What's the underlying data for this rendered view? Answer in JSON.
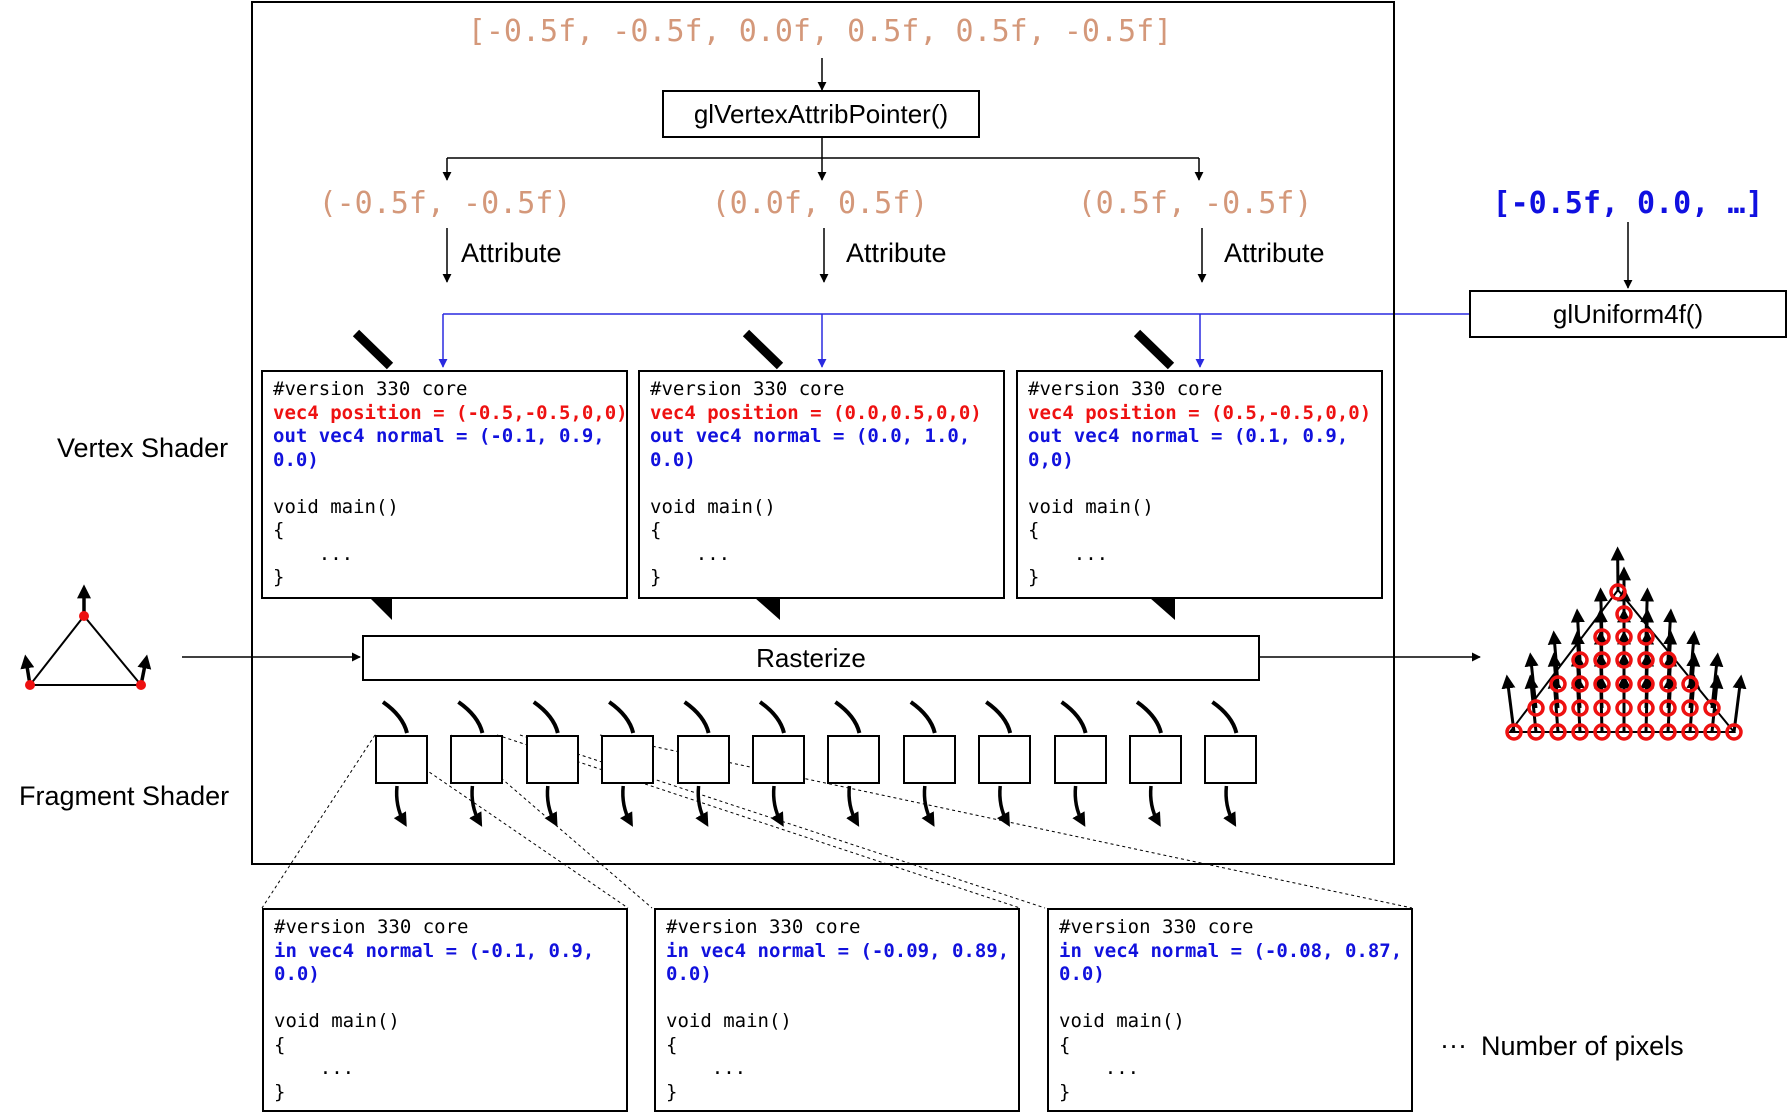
{
  "top_array": "[-0.5f, -0.5f, 0.0f, 0.5f, 0.5f, -0.5f]",
  "attrib_pointer_label": "glVertexAttribPointer()",
  "vertex_pairs": [
    "(-0.5f, -0.5f)",
    "(0.0f, 0.5f)",
    "(0.5f, -0.5f)"
  ],
  "attribute_label": "Attribute",
  "uniform_array": "[-0.5f, 0.0, …]",
  "uniform_call": "glUniform4f()",
  "vertex_shader_label": "Vertex Shader",
  "fragment_shader_label": "Fragment Shader",
  "rasterize_label": "Rasterize",
  "pixels_label": "Number of pixels",
  "ellipsis": "···",
  "vertex_shaders": [
    {
      "lines": [
        {
          "text": "#version 330 core",
          "style": "plain"
        },
        {
          "text": "vec4 position = (-0.5,-0.5,0,0)",
          "style": "red"
        },
        {
          "text": "out vec4 normal = (-0.1, 0.9,",
          "style": "blue"
        },
        {
          "text": "0.0)",
          "style": "blue"
        },
        {
          "text": "",
          "style": "plain"
        },
        {
          "text": "void main()",
          "style": "plain"
        },
        {
          "text": "{",
          "style": "plain"
        },
        {
          "text": "    ...",
          "style": "plain"
        },
        {
          "text": "}",
          "style": "plain"
        }
      ]
    },
    {
      "lines": [
        {
          "text": "#version 330 core",
          "style": "plain"
        },
        {
          "text": "vec4 position = (0.0,0.5,0,0)",
          "style": "red"
        },
        {
          "text": "out vec4 normal = (0.0, 1.0,",
          "style": "blue"
        },
        {
          "text": "0.0)",
          "style": "blue"
        },
        {
          "text": "",
          "style": "plain"
        },
        {
          "text": "void main()",
          "style": "plain"
        },
        {
          "text": "{",
          "style": "plain"
        },
        {
          "text": "    ...",
          "style": "plain"
        },
        {
          "text": "}",
          "style": "plain"
        }
      ]
    },
    {
      "lines": [
        {
          "text": "#version 330 core",
          "style": "plain"
        },
        {
          "text": "vec4 position = (0.5,-0.5,0,0)",
          "style": "red"
        },
        {
          "text": "out vec4 normal = (0.1, 0.9,",
          "style": "blue"
        },
        {
          "text": "0,0)",
          "style": "blue"
        },
        {
          "text": "",
          "style": "plain"
        },
        {
          "text": "void main()",
          "style": "plain"
        },
        {
          "text": "{",
          "style": "plain"
        },
        {
          "text": "    ...",
          "style": "plain"
        },
        {
          "text": "}",
          "style": "plain"
        }
      ]
    }
  ],
  "fragment_shaders": [
    {
      "lines": [
        {
          "text": "#version 330 core",
          "style": "plain"
        },
        {
          "text": "in vec4 normal = (-0.1, 0.9,",
          "style": "blue"
        },
        {
          "text": "0.0)",
          "style": "blue"
        },
        {
          "text": "",
          "style": "plain"
        },
        {
          "text": "void main()",
          "style": "plain"
        },
        {
          "text": "{",
          "style": "plain"
        },
        {
          "text": "    ...",
          "style": "plain"
        },
        {
          "text": "}",
          "style": "plain"
        }
      ]
    },
    {
      "lines": [
        {
          "text": "#version 330 core",
          "style": "plain"
        },
        {
          "text": "in vec4 normal = (-0.09, 0.89,",
          "style": "blue"
        },
        {
          "text": "0.0)",
          "style": "blue"
        },
        {
          "text": "",
          "style": "plain"
        },
        {
          "text": "void main()",
          "style": "plain"
        },
        {
          "text": "{",
          "style": "plain"
        },
        {
          "text": "    ...",
          "style": "plain"
        },
        {
          "text": "}",
          "style": "plain"
        }
      ]
    },
    {
      "lines": [
        {
          "text": "#version 330 core",
          "style": "plain"
        },
        {
          "text": "in vec4 normal = (-0.08, 0.87,",
          "style": "blue"
        },
        {
          "text": "0.0)",
          "style": "blue"
        },
        {
          "text": "",
          "style": "plain"
        },
        {
          "text": "void main()",
          "style": "plain"
        },
        {
          "text": "{",
          "style": "plain"
        },
        {
          "text": "    ...",
          "style": "plain"
        },
        {
          "text": "}",
          "style": "plain"
        }
      ]
    }
  ],
  "fragment_count": 12,
  "colors": {
    "value_text": "#d4987a",
    "uniform_text": "#1010e0",
    "position_text": "#ee1111",
    "normal_text": "#1111dd",
    "uniform_line": "#2a2ae0",
    "vertex_marker": "#ee1111"
  }
}
